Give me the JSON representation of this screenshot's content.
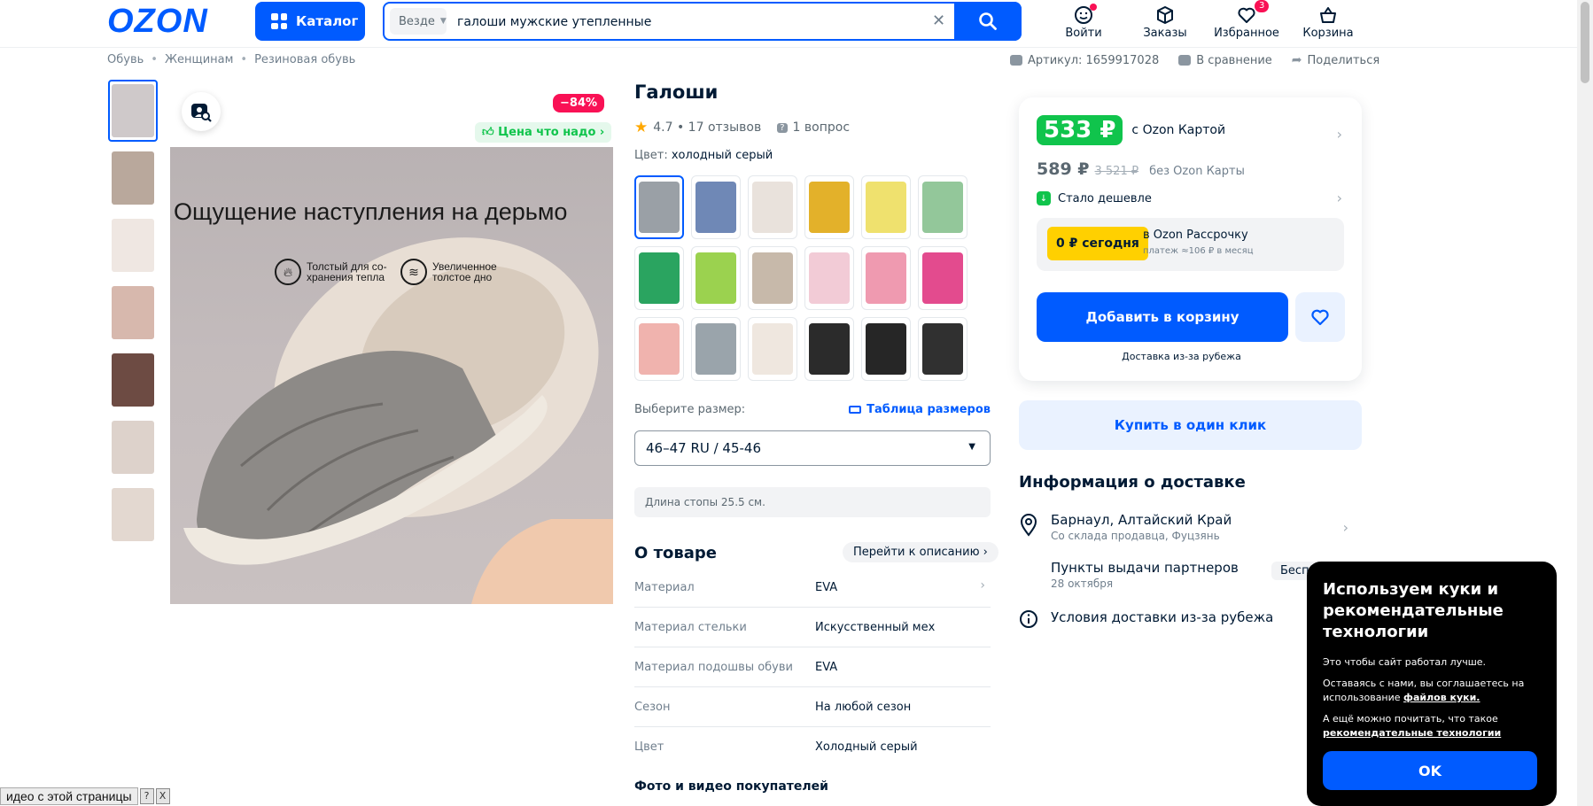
{
  "header": {
    "logo": "OZON",
    "catalog_label": "Каталог",
    "search_scope": "Везде",
    "search_value": "галоши мужские утепленные",
    "login_label": "Войти",
    "orders_label": "Заказы",
    "favorites_label": "Избранное",
    "favorites_count": "3",
    "cart_label": "Корзина"
  },
  "breadcrumbs": [
    "Обувь",
    "Женщинам",
    "Резиновая обувь"
  ],
  "meta": {
    "article": "Артикул: 1659917028",
    "compare": "В сравнение",
    "share": "Поделиться"
  },
  "gallery": {
    "discount": "−84%",
    "good_price": "Цена что надо",
    "overlay_title": "Ощущение наступления на дерьмо",
    "feature1": "Толстый для со-\nхранения тепла",
    "feature2": "Увеличенное\nтолстое дно",
    "thumb_colors": [
      "#cfc9ca",
      "#b9a89c",
      "#efe7e2",
      "#d7b8ad",
      "#6d4b43",
      "#ddd2cb",
      "#e3d8d0"
    ]
  },
  "product": {
    "title": "Галоши",
    "rating": "4.7 • 17 отзывов",
    "questions": "1 вопрос",
    "color_label": "Цвет:",
    "color_value": "холодный серый",
    "swatch_colors": [
      "#9aa0a6",
      "#6f88b6",
      "#e9e2dc",
      "#e3b12a",
      "#efe16e",
      "#93c79a",
      "#2aa460",
      "#9bd24f",
      "#c7b9aa",
      "#f2cbd6",
      "#ef9ab0",
      "#e34b8e",
      "#f0b3ae",
      "#9aa4ab",
      "#efe7df",
      "#2b2b2b",
      "#262626",
      "#303030"
    ],
    "size_label": "Выберите размер:",
    "size_table": "Таблица размеров",
    "size_value": "46–47 RU / 45-46",
    "foot_length": "Длина стопы 25.5 см.",
    "about_title": "О товаре",
    "to_description": "Перейти к описанию",
    "attributes": [
      {
        "k": "Материал",
        "v": "EVA"
      },
      {
        "k": "Материал стельки",
        "v": "Искусственный мех"
      },
      {
        "k": "Материал подошвы обуви",
        "v": "EVA"
      },
      {
        "k": "Сезон",
        "v": "На любой сезон"
      },
      {
        "k": "Цвет",
        "v": "Холодный серый"
      }
    ],
    "reviews_title": "Фото и видео покупателей"
  },
  "price_card": {
    "card_price": "533 ₽",
    "card_note": "с Ozon Картой",
    "price": "589 ₽",
    "old_price": "3 521 ₽",
    "no_card_note": "без Ozon Карты",
    "cheaper": "Стало дешевле",
    "installment_tag": "0 ₽ сегодня",
    "installment_title": "в Ozon Рассрочку",
    "installment_sub": "платеж ≈106 ₽ в месяц",
    "add_to_cart": "Добавить в корзину",
    "delivery_note": "Доставка из-за рубежа",
    "one_click": "Купить в один клик"
  },
  "delivery": {
    "title": "Информация о доставке",
    "city": "Барнаул, Алтайский Край",
    "warehouse": "Со склада продавца, Фуцзянь",
    "pickup": "Пункты выдачи партнеров",
    "pickup_date": "28 октября",
    "free": "Бесплатно",
    "conditions": "Условия доставки из-за рубежа"
  },
  "cookie": {
    "title": "Используем куки и рекомендательные технологии",
    "p1": "Это чтобы сайт работал лучше.",
    "p2a": "Оставаясь с нами, вы соглашаетесь на использование ",
    "p2link": "файлов куки.",
    "p3a": "А ещё можно почитать, что такое ",
    "p3link": "рекомендательные технологии",
    "ok": "OK"
  },
  "video_bar": {
    "text": "идео с этой страницы",
    "help": "?",
    "close": "X"
  },
  "colors": {
    "brand_blue": "#005bff",
    "green": "#10c44c",
    "pink": "#f91155",
    "yellow": "#ffd000"
  }
}
